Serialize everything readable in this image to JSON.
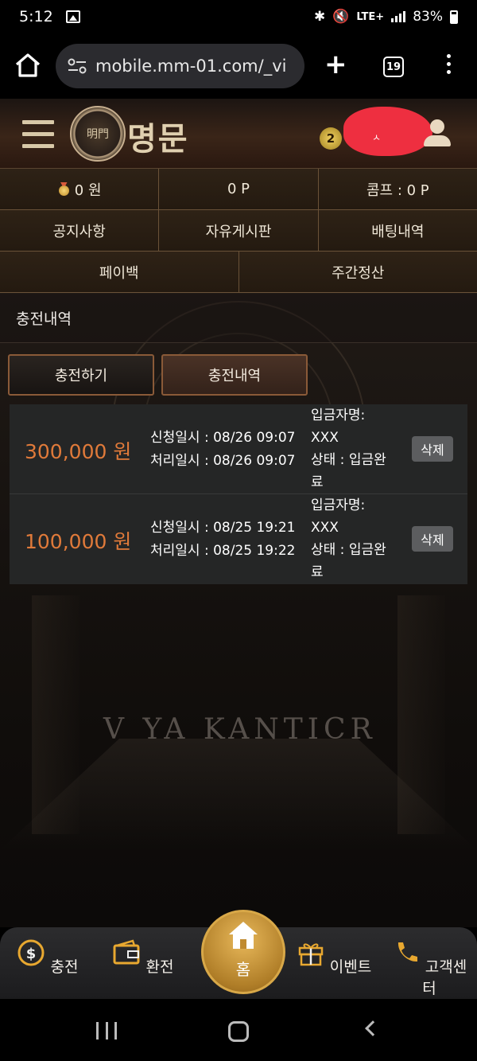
{
  "status_bar": {
    "time": "5:12",
    "network": "LTE+",
    "battery": "83%"
  },
  "browser": {
    "url": "mobile.mm-01.com/_vi",
    "tab_count": "19"
  },
  "header": {
    "logo_text": "명문",
    "level": "2",
    "username": "ㅅ"
  },
  "info_grid": {
    "balance": "0 원",
    "points": "0 P",
    "comp": "콤프 : 0 P",
    "menu": [
      "공지사항",
      "자유게시판",
      "배팅내역"
    ],
    "menu2": [
      "페이백",
      "주간정산"
    ]
  },
  "page": {
    "title": "충전내역",
    "tabs": [
      "충전하기",
      "충전내역"
    ]
  },
  "deposits": [
    {
      "amount": "300,000 원",
      "requested": "신청일시 : 08/26 09:07",
      "processed": "처리일시 : 08/26 09:07",
      "depositor_label": "입금자명:",
      "depositor": "XXX",
      "status_line1": "상태 : 입금완",
      "status_line2": "료",
      "delete_label": "삭제"
    },
    {
      "amount": "100,000 원",
      "requested": "신청일시 : 08/25 19:21",
      "processed": "처리일시 : 08/25 19:22",
      "depositor_label": "입금자명:",
      "depositor": "XXX",
      "status_line1": "상태 : 입금완",
      "status_line2": "료",
      "delete_label": "삭제"
    }
  ],
  "background_text": "V YA KANTICR",
  "bottom_nav": {
    "charge": "충전",
    "exchange": "환전",
    "home": "홈",
    "event": "이벤트",
    "support": "고객센터"
  },
  "colors": {
    "accent_amount": "#e07a3a",
    "header_brown": "#3a2518",
    "gold": "#d8a848"
  }
}
